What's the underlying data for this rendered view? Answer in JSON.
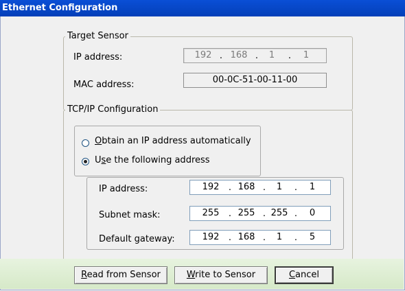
{
  "window": {
    "title": "Ethernet Configuration"
  },
  "target_sensor": {
    "title": "Target Sensor",
    "ip_label": "IP address:",
    "ip": [
      "192",
      "168",
      "1",
      "1"
    ],
    "mac_label": "MAC address:",
    "mac": "00-0C-51-00-11-00"
  },
  "tcpip": {
    "title": "TCP/IP Configuration",
    "auto": {
      "accel": "O",
      "rest": "btain an IP address automatically",
      "checked": false
    },
    "manual": {
      "prefix": "U",
      "accel": "s",
      "rest": "e the following address",
      "checked": true
    },
    "ip_label": "IP address:",
    "ip": [
      "192",
      "168",
      "1",
      "1"
    ],
    "subnet_label": "Subnet mask:",
    "subnet": [
      "255",
      "255",
      "255",
      "0"
    ],
    "gateway_label": "Default gateway:",
    "gateway": [
      "192",
      "168",
      "1",
      "5"
    ]
  },
  "buttons": {
    "read": {
      "accel": "R",
      "rest": "ead from Sensor"
    },
    "write": {
      "accel": "W",
      "rest": "rite to Sensor"
    },
    "cancel": {
      "accel": "C",
      "rest": "ancel"
    }
  }
}
